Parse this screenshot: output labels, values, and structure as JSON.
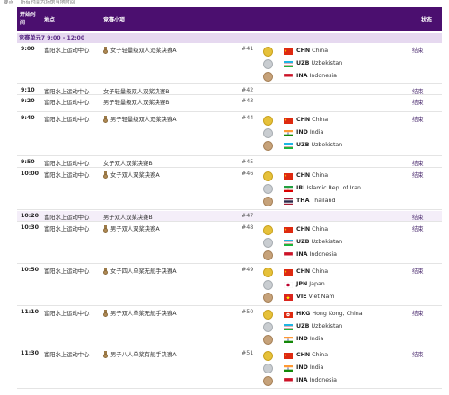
{
  "top_note": {
    "label": "要点",
    "text": "所有时间为场馆当地时间"
  },
  "header": {
    "time": "开始时间",
    "venue": "地点",
    "event": "竞赛小项",
    "status": "状态"
  },
  "session": "竞赛单元7 9:00 - 12:00",
  "rows": [
    {
      "time": "9:00",
      "venue": "富阳水上运动中心",
      "event": "女子轻量级双人双桨决赛A",
      "medal_event": true,
      "code": "#41",
      "status": "结束",
      "results": [
        {
          "code": "CHN",
          "name": "China",
          "flag": "chn",
          "medal": "gold"
        },
        {
          "code": "UZB",
          "name": "Uzbekistan",
          "flag": "uzb",
          "medal": "silver"
        },
        {
          "code": "INA",
          "name": "Indonesia",
          "flag": "ina",
          "medal": "bronze"
        }
      ]
    },
    {
      "time": "9:10",
      "venue": "富阳水上运动中心",
      "event": "女子轻量级双人双桨决赛B",
      "medal_event": false,
      "code": "#42",
      "status": "结束",
      "results": []
    },
    {
      "time": "9:20",
      "venue": "富阳水上运动中心",
      "event": "男子轻量级双人双桨决赛B",
      "medal_event": false,
      "code": "#43",
      "status": "结束",
      "results": []
    },
    {
      "time": "9:40",
      "venue": "富阳水上运动中心",
      "event": "男子轻量级双人双桨决赛A",
      "medal_event": true,
      "code": "#44",
      "status": "结束",
      "results": [
        {
          "code": "CHN",
          "name": "China",
          "flag": "chn",
          "medal": "gold"
        },
        {
          "code": "IND",
          "name": "India",
          "flag": "ind",
          "medal": "silver"
        },
        {
          "code": "UZB",
          "name": "Uzbekistan",
          "flag": "uzb",
          "medal": "bronze"
        }
      ]
    },
    {
      "time": "9:50",
      "venue": "富阳水上运动中心",
      "event": "女子双人双桨决赛B",
      "medal_event": false,
      "code": "#45",
      "status": "结束",
      "results": []
    },
    {
      "time": "10:00",
      "venue": "富阳水上运动中心",
      "event": "女子双人双桨决赛A",
      "medal_event": true,
      "code": "#46",
      "status": "结束",
      "results": [
        {
          "code": "CHN",
          "name": "China",
          "flag": "chn",
          "medal": "gold"
        },
        {
          "code": "IRI",
          "name": "Islamic Rep. of Iran",
          "flag": "iri",
          "medal": "silver"
        },
        {
          "code": "THA",
          "name": "Thailand",
          "flag": "tha",
          "medal": "bronze"
        }
      ]
    },
    {
      "time": "10:20",
      "venue": "富阳水上运动中心",
      "event": "男子双人双桨决赛B",
      "medal_event": false,
      "code": "#47",
      "status": "结束",
      "results": [],
      "highlight": true
    },
    {
      "time": "10:30",
      "venue": "富阳水上运动中心",
      "event": "男子双人双桨决赛A",
      "medal_event": true,
      "code": "#48",
      "status": "结束",
      "results": [
        {
          "code": "CHN",
          "name": "China",
          "flag": "chn",
          "medal": "gold"
        },
        {
          "code": "UZB",
          "name": "Uzbekistan",
          "flag": "uzb",
          "medal": "silver"
        },
        {
          "code": "INA",
          "name": "Indonesia",
          "flag": "ina",
          "medal": "bronze"
        }
      ]
    },
    {
      "time": "10:50",
      "venue": "富阳水上运动中心",
      "event": "女子四人单桨无舵手决赛A",
      "medal_event": true,
      "code": "#49",
      "status": "结束",
      "results": [
        {
          "code": "CHN",
          "name": "China",
          "flag": "chn",
          "medal": "gold"
        },
        {
          "code": "JPN",
          "name": "Japan",
          "flag": "jpn",
          "medal": "silver"
        },
        {
          "code": "VIE",
          "name": "Viet Nam",
          "flag": "vie",
          "medal": "bronze"
        }
      ]
    },
    {
      "time": "11:10",
      "venue": "富阳水上运动中心",
      "event": "男子双人单桨无舵手决赛A",
      "medal_event": true,
      "code": "#50",
      "status": "结束",
      "results": [
        {
          "code": "HKG",
          "name": "Hong Kong, China",
          "flag": "hkg",
          "medal": "gold"
        },
        {
          "code": "UZB",
          "name": "Uzbekistan",
          "flag": "uzb",
          "medal": "silver"
        },
        {
          "code": "IND",
          "name": "India",
          "flag": "ind",
          "medal": "bronze"
        }
      ]
    },
    {
      "time": "11:30",
      "venue": "富阳水上运动中心",
      "event": "男子八人单桨有舵手决赛A",
      "medal_event": true,
      "code": "#51",
      "status": "结束",
      "results": [
        {
          "code": "CHN",
          "name": "China",
          "flag": "chn",
          "medal": "gold"
        },
        {
          "code": "IND",
          "name": "India",
          "flag": "ind",
          "medal": "silver"
        },
        {
          "code": "INA",
          "name": "Indonesia",
          "flag": "ina",
          "medal": "bronze"
        }
      ]
    }
  ]
}
